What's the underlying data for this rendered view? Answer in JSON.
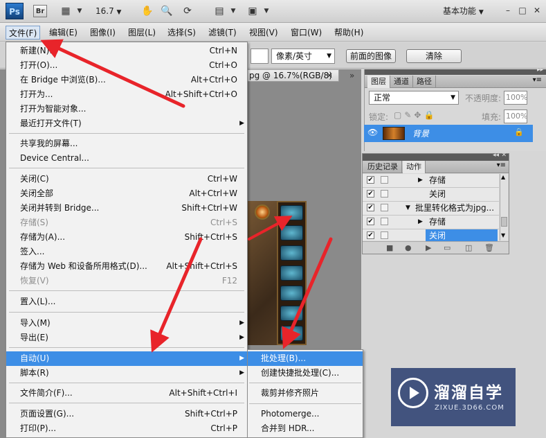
{
  "app": {
    "logo": "Ps",
    "bridge": "Br",
    "zoom": "16.7",
    "workspace": "基本功能",
    "window_controls": [
      "–",
      "□",
      "✕"
    ]
  },
  "menubar": {
    "items": [
      "文件(F)",
      "编辑(E)",
      "图像(I)",
      "图层(L)",
      "选择(S)",
      "滤镜(T)",
      "视图(V)",
      "窗口(W)",
      "帮助(H)"
    ],
    "active_index": 0
  },
  "options": {
    "unit": "像素/英寸",
    "front_image": "前面的图像",
    "clear": "清除"
  },
  "document": {
    "tab": "pg @ 16.7%(RGB/8)",
    "collapse": "»"
  },
  "file_menu": {
    "items": [
      {
        "label": "新建(N)...",
        "shortcut": "Ctrl+N"
      },
      {
        "label": "打开(O)...",
        "shortcut": "Ctrl+O"
      },
      {
        "label": "在 Bridge 中浏览(B)...",
        "shortcut": "Alt+Ctrl+O"
      },
      {
        "label": "打开为...",
        "shortcut": "Alt+Shift+Ctrl+O"
      },
      {
        "label": "打开为智能对象...",
        "shortcut": ""
      },
      {
        "label": "最近打开文件(T)",
        "shortcut": ""
      },
      {
        "label": "共享我的屏幕...",
        "shortcut": ""
      },
      {
        "label": "Device Central...",
        "shortcut": ""
      },
      {
        "label": "关闭(C)",
        "shortcut": "Ctrl+W"
      },
      {
        "label": "关闭全部",
        "shortcut": "Alt+Ctrl+W"
      },
      {
        "label": "关闭并转到 Bridge...",
        "shortcut": "Shift+Ctrl+W"
      },
      {
        "label": "存储(S)",
        "shortcut": "Ctrl+S"
      },
      {
        "label": "存储为(A)...",
        "shortcut": "Shift+Ctrl+S"
      },
      {
        "label": "签入...",
        "shortcut": ""
      },
      {
        "label": "存储为 Web 和设备所用格式(D)...",
        "shortcut": "Alt+Shift+Ctrl+S"
      },
      {
        "label": "恢复(V)",
        "shortcut": "F12"
      },
      {
        "label": "置入(L)...",
        "shortcut": ""
      },
      {
        "label": "导入(M)",
        "shortcut": ""
      },
      {
        "label": "导出(E)",
        "shortcut": ""
      },
      {
        "label": "自动(U)",
        "shortcut": ""
      },
      {
        "label": "脚本(R)",
        "shortcut": ""
      },
      {
        "label": "文件简介(F)...",
        "shortcut": "Alt+Shift+Ctrl+I"
      },
      {
        "label": "页面设置(G)...",
        "shortcut": "Shift+Ctrl+P"
      },
      {
        "label": "打印(P)...",
        "shortcut": "Ctrl+P"
      }
    ]
  },
  "auto_menu": {
    "items": [
      "批处理(B)...",
      "创建快捷批处理(C)...",
      "裁剪并修齐照片",
      "Photomerge...",
      "合并到 HDR..."
    ]
  },
  "layers_panel": {
    "tabs": [
      "图层",
      "通道",
      "路径"
    ],
    "blend_mode": "正常",
    "opacity_label": "不透明度:",
    "opacity": "100%",
    "lock_label": "锁定:",
    "fill_label": "填充:",
    "fill": "100%",
    "layer_name": "背景"
  },
  "history_panel": {
    "tabs": [
      "历史记录",
      "动作"
    ],
    "rows": [
      {
        "text": "存储",
        "indent": 2,
        "arrow": "▶"
      },
      {
        "text": "关闭",
        "indent": 2,
        "arrow": ""
      },
      {
        "text": "批里转化格式为jpg...",
        "indent": 1,
        "arrow": "▼"
      },
      {
        "text": "存储",
        "indent": 2,
        "arrow": "▶"
      },
      {
        "text": "关闭",
        "indent": 2,
        "arrow": ""
      }
    ]
  },
  "watermark": {
    "title": "溜溜自学",
    "url": "ZIXUE.3D66.COM"
  }
}
